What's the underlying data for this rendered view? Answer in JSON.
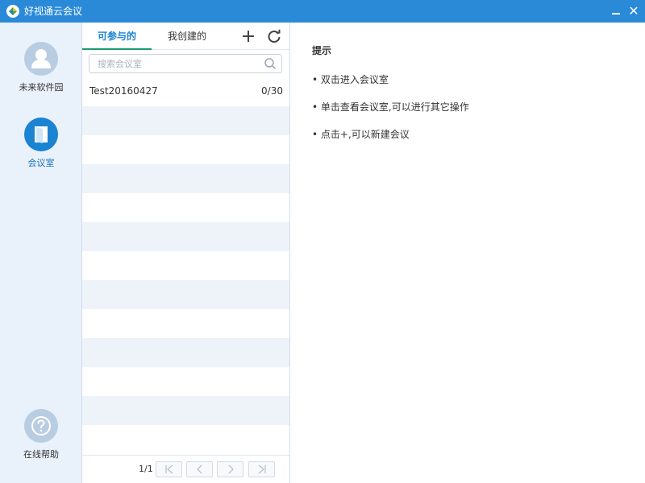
{
  "window": {
    "title": "好视通云会议",
    "minimize_label": "—",
    "close_label": "✕"
  },
  "leftnav": {
    "items": [
      {
        "label": "未来软件园",
        "icon": "user-avatar-icon"
      },
      {
        "label": "会议室",
        "icon": "meeting-room-door-icon"
      },
      {
        "label": "在线帮助",
        "icon": "help-question-icon"
      }
    ]
  },
  "list_panel": {
    "tabs": [
      {
        "label": "可参与的",
        "active": true
      },
      {
        "label": "我创建的",
        "active": false
      }
    ],
    "search": {
      "placeholder": "搜索会议室",
      "value": ""
    },
    "rooms": [
      {
        "name": "Test20160427",
        "count": "0/30"
      }
    ],
    "pagination": {
      "page_info": "1/1"
    }
  },
  "tips": {
    "heading": "提示",
    "items": [
      "• 双击进入会议室",
      "• 单击查看会议室,可以进行其它操作",
      "• 点击+,可以新建会议"
    ]
  },
  "colors": {
    "titlebar": "#2a8ad8",
    "accent": "#1a83d2",
    "tab_underline": "#1a9a6b",
    "nav_bg": "#e9f1fb",
    "row_alt": "#eef3f9"
  }
}
